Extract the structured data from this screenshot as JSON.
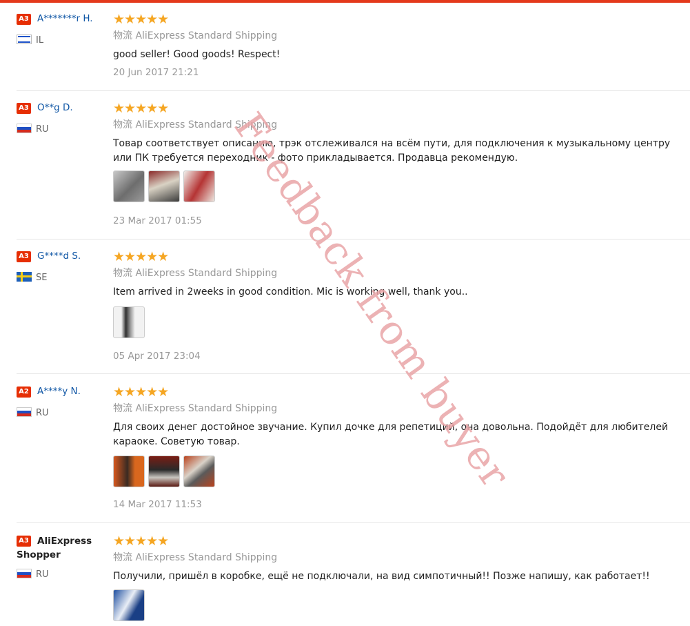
{
  "watermark": "Feedback from buyer",
  "shipping_prefix": "物流",
  "reviews": [
    {
      "level": "A3",
      "name": "A*******r H.",
      "country": "IL",
      "stars": "★★★★★",
      "shipping": "AliExpress Standard Shipping",
      "text": "good seller! Good goods! Respect!",
      "date": "20 Jun 2017 21:21",
      "photos": 0
    },
    {
      "level": "A3",
      "name": "O**g D.",
      "country": "RU",
      "stars": "★★★★★",
      "shipping": "AliExpress Standard Shipping",
      "text": "Товар соответствует описанию, трэк отслеживался на всём пути, для подключения к музыкальному центру или ПК требуется переходник - фото прикладывается. Продавца рекомендую.",
      "date": "23 Mar 2017 01:55",
      "photos": 3
    },
    {
      "level": "A3",
      "name": "G****d S.",
      "country": "SE",
      "stars": "★★★★★",
      "shipping": "AliExpress Standard Shipping",
      "text": "Item arrived in 2weeks in good condition. Mic is working well, thank you..",
      "date": "05 Apr 2017 23:04",
      "photos": 1
    },
    {
      "level": "A2",
      "name": "A****y N.",
      "country": "RU",
      "stars": "★★★★★",
      "shipping": "AliExpress Standard Shipping",
      "text": "Для своих денег достойное звучание. Купил дочке для репетиций, она довольна. Подойдёт для любителей караоке. Советую товар.",
      "date": "14 Mar 2017 11:53",
      "photos": 3
    },
    {
      "level": "A3",
      "name": "AliExpress Shopper",
      "country": "RU",
      "stars": "★★★★★",
      "shipping": "AliExpress Standard Shipping",
      "text": "Получили, пришёл в коробке, ещё не подключали, на вид симпотичный!! Позже напишу, как работает!!",
      "date": "",
      "photos": 1
    }
  ]
}
